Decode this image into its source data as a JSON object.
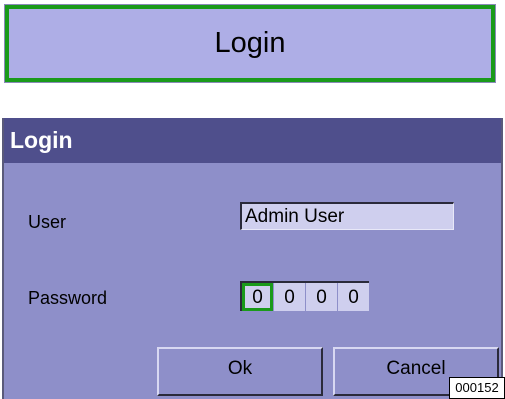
{
  "top_button": {
    "label": "Login"
  },
  "dialog": {
    "title": "Login",
    "user": {
      "label": "User",
      "value": "Admin User"
    },
    "password": {
      "label": "Password",
      "digits": [
        "0",
        "0",
        "0",
        "0"
      ]
    },
    "ok_label": "Ok",
    "cancel_label": "Cancel"
  },
  "reference_code": "000152",
  "colors": {
    "button_bg": "#aeaee6",
    "focus_border": "#1a9a1a",
    "dialog_bg": "#8e8fc9",
    "header_bg": "#4f4f8c",
    "field_bg": "#cfcfee"
  }
}
